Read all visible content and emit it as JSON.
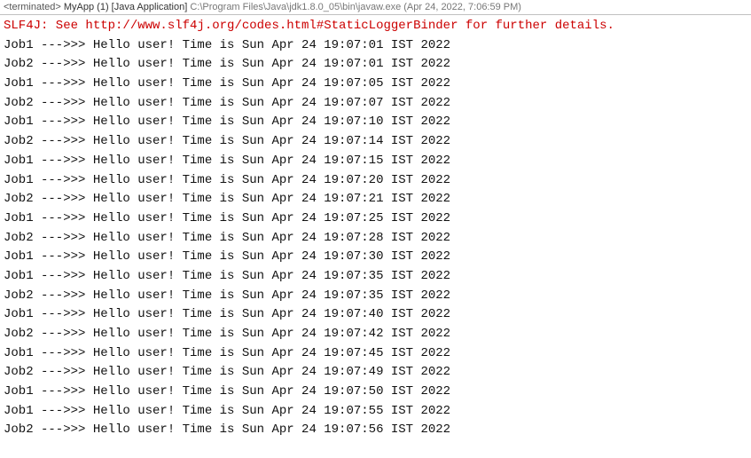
{
  "header": {
    "terminated": "<terminated>",
    "app_name": "MyApp (1) [Java Application]",
    "path": "C:\\Program Files\\Java\\jdk1.8.0_05\\bin\\javaw.exe (Apr 24, 2022, 7:06:59 PM)"
  },
  "console": {
    "slf4j_message": "SLF4J: See http://www.slf4j.org/codes.html#StaticLoggerBinder for further details.",
    "lines": [
      "Job1 --->>> Hello user! Time is Sun Apr 24 19:07:01 IST 2022",
      "Job2 --->>> Hello user! Time is Sun Apr 24 19:07:01 IST 2022",
      "Job1 --->>> Hello user! Time is Sun Apr 24 19:07:05 IST 2022",
      "Job2 --->>> Hello user! Time is Sun Apr 24 19:07:07 IST 2022",
      "Job1 --->>> Hello user! Time is Sun Apr 24 19:07:10 IST 2022",
      "Job2 --->>> Hello user! Time is Sun Apr 24 19:07:14 IST 2022",
      "Job1 --->>> Hello user! Time is Sun Apr 24 19:07:15 IST 2022",
      "Job1 --->>> Hello user! Time is Sun Apr 24 19:07:20 IST 2022",
      "Job2 --->>> Hello user! Time is Sun Apr 24 19:07:21 IST 2022",
      "Job1 --->>> Hello user! Time is Sun Apr 24 19:07:25 IST 2022",
      "Job2 --->>> Hello user! Time is Sun Apr 24 19:07:28 IST 2022",
      "Job1 --->>> Hello user! Time is Sun Apr 24 19:07:30 IST 2022",
      "Job1 --->>> Hello user! Time is Sun Apr 24 19:07:35 IST 2022",
      "Job2 --->>> Hello user! Time is Sun Apr 24 19:07:35 IST 2022",
      "Job1 --->>> Hello user! Time is Sun Apr 24 19:07:40 IST 2022",
      "Job2 --->>> Hello user! Time is Sun Apr 24 19:07:42 IST 2022",
      "Job1 --->>> Hello user! Time is Sun Apr 24 19:07:45 IST 2022",
      "Job2 --->>> Hello user! Time is Sun Apr 24 19:07:49 IST 2022",
      "Job1 --->>> Hello user! Time is Sun Apr 24 19:07:50 IST 2022",
      "Job1 --->>> Hello user! Time is Sun Apr 24 19:07:55 IST 2022",
      "Job2 --->>> Hello user! Time is Sun Apr 24 19:07:56 IST 2022"
    ]
  }
}
